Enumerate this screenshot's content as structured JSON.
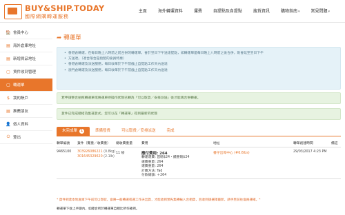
{
  "brand": {
    "name": "BUY&SHIP.TODAY",
    "subtitle": "國際網購轉運服務"
  },
  "nav": [
    {
      "label": "主頁",
      "caret": ""
    },
    {
      "label": "海外轉運資料",
      "caret": ""
    },
    {
      "label": "運費",
      "caret": ""
    },
    {
      "label": "自提點及自提點",
      "caret": ""
    },
    {
      "label": "搜貨資訊",
      "caret": ""
    },
    {
      "label": "購物指南",
      "caret": "▾"
    },
    {
      "label": "常見問題",
      "caret": "▾"
    }
  ],
  "sidebar": [
    {
      "icon": "🏠",
      "label": "會員中心",
      "active": false
    },
    {
      "icon": "▤",
      "label": "海外倉庫地址",
      "active": false
    },
    {
      "icon": "▤",
      "label": "新增貨品地址",
      "active": false
    },
    {
      "icon": "▢",
      "label": "貨件收到管理",
      "active": false
    },
    {
      "icon": "▢",
      "label": "轉運單",
      "active": true
    },
    {
      "icon": "$",
      "label": "我的賬戶",
      "active": false
    },
    {
      "icon": "▤",
      "label": "推薦朋友",
      "active": false
    },
    {
      "icon": "👤",
      "label": "個人資料",
      "active": false
    },
    {
      "icon": "⏻",
      "label": "登出",
      "active": false
    }
  ],
  "page": {
    "title": "轉運單"
  },
  "info_lines": [
    "香港倉轉運，在每日晚上八時前之前合併的轉運單，會於翌日下午送達提點，如轉運單是每日晚上八時前之後合併，則會延至翌日下午",
    "方送達。（適合限合是指配的會員特惠）",
    "香港倉轉運及派送服務，每日收單於下午前截止自提點工作天內送達",
    "澳門倉轉運及派送服務，每日收單於下午前截止自提點工作天內送達"
  ],
  "notice1": "若申請整合拍照轉運單或將運單待操作狀態已轉為「可以取貨／安排派送」後才能再合併轉運。",
  "notice2": "貨件已完成總結為集運貨式，您可以在「轉運單」得到最新的狀態",
  "tabs": [
    {
      "label": "未完成單",
      "badge": "1",
      "active": true
    },
    {
      "label": "準備發貨",
      "badge": "",
      "active": false
    },
    {
      "label": "可以取貨／安排派送",
      "badge": "",
      "active": false
    },
    {
      "label": "完成",
      "badge": "",
      "active": false
    }
  ],
  "table": {
    "headers": [
      "轉單編號",
      "貨件（實重／收費重）",
      "總收費重量",
      "費用",
      "地址",
      "轉單創建時間",
      "備註"
    ],
    "rows": [
      {
        "id": "9465100",
        "items": [
          {
            "code": "303926086221",
            "weight": "(0.8kg)"
          },
          {
            "code": "301645329620",
            "weight": "(2.1lb)"
          }
        ],
        "total_weight": "11 磅",
        "fee_title": "應付費用: 264",
        "fee_lines": [
          "轉運運費: 首磅$24・續重磅$24",
          "運費重量: 264",
          "運費重量: 264",
          "計費方法: Tad",
          "付款總額: ＋264"
        ],
        "address": "番仔出埠中心 (#6.6lbs)",
        "created": "29/03/2017 4:23 PM",
        "remark": ""
      }
    ]
  },
  "footnote1": "* 貨件到達本地倉庫下午前可以寄取，會將一般轉運或運工作天出貨，才能收到預先集轉輸入合相貨，且收到請選擇最新，請手至前往會員運確。*",
  "footnote2": "轉運單下收上手期內，如總合所於轉運單自相比所作確例。"
}
